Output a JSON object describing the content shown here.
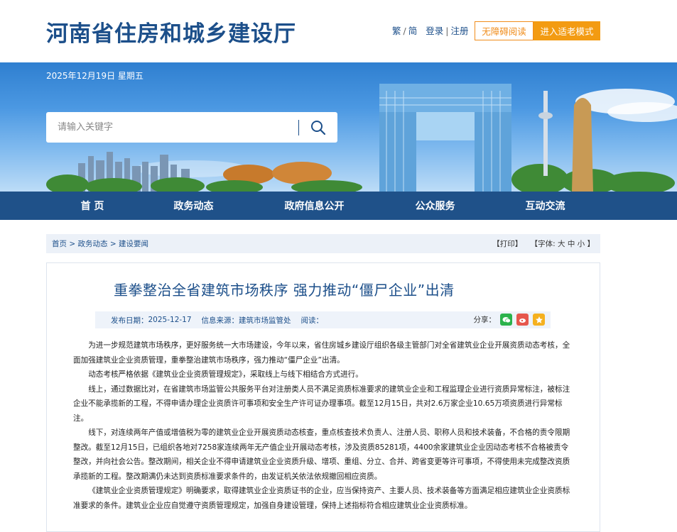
{
  "header": {
    "site_title": "河南省住房和城乡建设厅",
    "lang_trad": "繁",
    "lang_simp": "简",
    "login": "登录",
    "register": "注册",
    "accessible_read": "无障碍阅读",
    "elder_mode": "进入适老模式"
  },
  "banner": {
    "date": "2025年12月19日 星期五",
    "search_placeholder": "请输入关键字"
  },
  "nav": {
    "items": [
      "首  页",
      "政务动态",
      "政府信息公开",
      "公众服务",
      "互动交流"
    ]
  },
  "breadcrumb": {
    "home": "首页",
    "level1": "政务动态",
    "level2": "建设要闻",
    "sep": ">",
    "print": "【打印】",
    "font_label": "【字体:",
    "font_large": "大",
    "font_mid": "中",
    "font_small": "小",
    "font_end": "】"
  },
  "article": {
    "title": "重拳整治全省建筑市场秩序 强力推动“僵尸企业”出清",
    "publish_label": "发布日期：",
    "publish_date": "2025-12-17",
    "source_label": "信息来源：",
    "source": "建筑市场监管处",
    "views_label": "阅读：",
    "share_label": "分享：",
    "paragraphs": [
      "为进一步规范建筑市场秩序，更好服务统一大市场建设，今年以来，省住房城乡建设厅组织各级主管部门对全省建筑业企业开展资质动态考核，全面加强建筑业企业资质管理，重拳整治建筑市场秩序，强力推动“僵尸企业”出清。",
      "动态考核严格依据《建筑业企业资质管理规定》，采取线上与线下相结合方式进行。",
      "线上，通过数据比对，在省建筑市场监管公共服务平台对注册类人员不满足资质标准要求的建筑业企业和工程监理企业进行资质异常标注，被标注企业不能承揽新的工程，不得申请办理企业资质许可事项和安全生产许可证办理事项。截至12月15日，共对2.6万家企业10.65万项资质进行异常标注。",
      "线下，对连续两年产值或增值税为零的建筑业企业开展资质动态核查，重点核查技术负责人、注册人员、职称人员和技术装备，不合格的责令限期整改。截至12月15日，已组织各地对7258家连续两年无产值企业开展动态考核，涉及资质85281项，4400余家建筑业企业因动态考核不合格被责令整改，并向社会公告。整改期间，相关企业不得申请建筑业企业资质升级、增项、重组、分立、合并、跨省变更等许可事项，不得使用未完成整改资质承揽新的工程。整改期满仍未达到资质标准要求条件的，由发证机关依法依规撤回相应资质。",
      "《建筑业企业资质管理规定》明确要求，取得建筑业企业资质证书的企业，应当保持资产、主要人员、技术装备等方面满足相应建筑业企业资质标准要求的条件。建筑业企业应自觉遵守资质管理规定，加强自身建设管理，保持上述指标符合相应建筑业企业资质标准。"
    ]
  },
  "colors": {
    "brand_blue": "#1c4f8a",
    "nav_blue": "#1f5189",
    "orange": "#f39b12",
    "wechat": "#2bb24c",
    "weibo": "#e6574d",
    "qzone": "#f5b120"
  }
}
